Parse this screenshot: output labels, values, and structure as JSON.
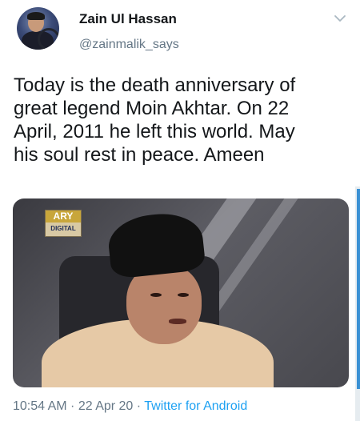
{
  "tweet": {
    "author": {
      "display_name": "Zain Ul Hassan",
      "handle": "@zainmalik_says",
      "avatar_icon": "user-avatar"
    },
    "menu_icon": "chevron-down-icon",
    "text": "Today is the death anniversary of\ngreat legend Moin Akhtar. On 22\nApril, 2011 he left this world. May\nhis soul rest in peace. Ameen",
    "media": {
      "logo_top": "ARY",
      "logo_bottom": "DIGITAL"
    },
    "meta": {
      "time": "10:54 AM",
      "separator": " · ",
      "date": "22 Apr 20",
      "app": "Twitter for Android"
    }
  },
  "colors": {
    "link": "#1da1f2",
    "secondary_text": "#657786",
    "scrollbar": "#3a91d4"
  }
}
